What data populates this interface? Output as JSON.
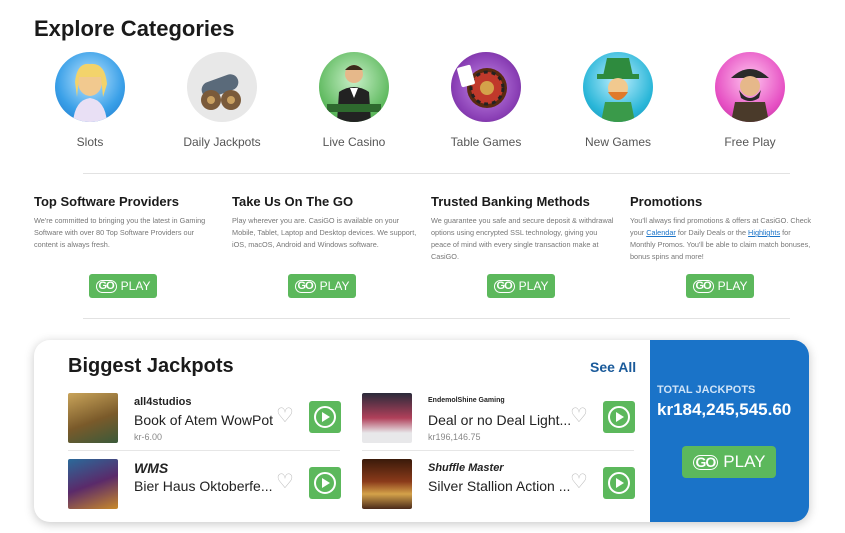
{
  "explore": {
    "title": "Explore Categories"
  },
  "categories": [
    {
      "label": "Slots",
      "icon": "slots-character-icon",
      "color": "#3aa0e8"
    },
    {
      "label": "Daily Jackpots",
      "icon": "cannon-icon",
      "color": "#e6e6e6"
    },
    {
      "label": "Live Casino",
      "icon": "dealer-icon",
      "color": "#5cb85c"
    },
    {
      "label": "Table Games",
      "icon": "roulette-icon",
      "color": "#8a3fb5"
    },
    {
      "label": "New Games",
      "icon": "leprechaun-icon",
      "color": "#29b6d8"
    },
    {
      "label": "Free Play",
      "icon": "pirate-character-icon",
      "color": "#e64fc3"
    }
  ],
  "info": [
    {
      "title": "Top Software Providers",
      "text": "We're committed to bringing you the latest in Gaming Software with over 80 Top Software Providers our content is always fresh.",
      "button": "PLAY"
    },
    {
      "title": "Take Us On The GO",
      "text": "Play wherever you are. CasiGO is available on your Mobile, Tablet, Laptop and Desktop devices. We support, iOS, macOS, Android and Windows software.",
      "button": "PLAY"
    },
    {
      "title": "Trusted Banking Methods",
      "text": "We guarantee you safe and secure deposit & withdrawal options using encrypted SSL technology, giving you peace of mind with every single transaction make at CasiGO.",
      "button": "PLAY"
    },
    {
      "title": "Promotions",
      "text_a": "You'll always find promotions & offers at CasiGO. Check your ",
      "link_calendar": "Calendar",
      "text_b": " for Daily Deals or the ",
      "link_highlights": "Highlights",
      "text_c": " for Monthly Promos. You'll be able to claim match bonuses, bonus spins and more!",
      "button": "PLAY"
    }
  ],
  "go_logo": "GO",
  "jackpots": {
    "title": "Biggest Jackpots",
    "see_all": "See All",
    "total_label": "TOTAL JACKPOTS",
    "total_amount": "kr184,245,545.60",
    "play": "PLAY",
    "games": [
      {
        "brand": "all4studios",
        "name": "Book of Atem WowPot",
        "amount": "kr-6.00",
        "thumb_color": "#7a5a2a"
      },
      {
        "brand": "EndemolShine Gaming",
        "name": "Deal or no Deal Light...",
        "amount": "kr196,146.75",
        "thumb_color": "#b0405a"
      },
      {
        "brand": "WMS",
        "name": "Bier Haus Oktoberfe...",
        "amount": "",
        "thumb_color": "#5a2a6a"
      },
      {
        "brand": "Shuffle Master",
        "name": "Silver Stallion Action ...",
        "amount": "",
        "thumb_color": "#8a3a1a"
      }
    ]
  }
}
